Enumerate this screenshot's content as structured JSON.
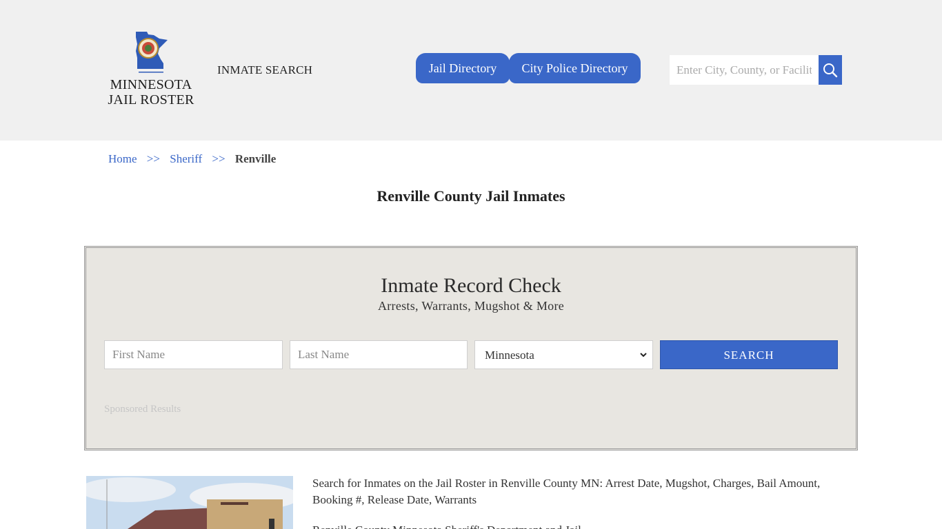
{
  "header": {
    "logo_line1": "MINNESOTA",
    "logo_line2": "JAIL ROSTER",
    "nav_inmate_search": "INMATE SEARCH",
    "jail_directory": "Jail Directory",
    "city_police_directory": "City Police Directory",
    "search_placeholder": "Enter City, County, or Facility",
    "accent_color": "#3a67c8"
  },
  "breadcrumb": {
    "home": "Home",
    "sep": ">>",
    "sheriff": "Sheriff",
    "current": "Renville"
  },
  "page_title": "Renville County Jail Inmates",
  "record_check": {
    "title": "Inmate Record Check",
    "subtitle": "Arrests, Warrants, Mugshot & More",
    "first_name_placeholder": "First Name",
    "last_name_placeholder": "Last Name",
    "state_selected": "Minnesota",
    "search_button": "SEARCH",
    "sponsored": "Sponsored Results"
  },
  "content": {
    "intro": "Search for Inmates on the Jail Roster in Renville County MN: Arrest Date, Mugshot, Charges, Bail Amount, Booking #, Release Date, Warrants",
    "intro2": "Renville County Minnesota Sheriff's Department and Jail"
  }
}
